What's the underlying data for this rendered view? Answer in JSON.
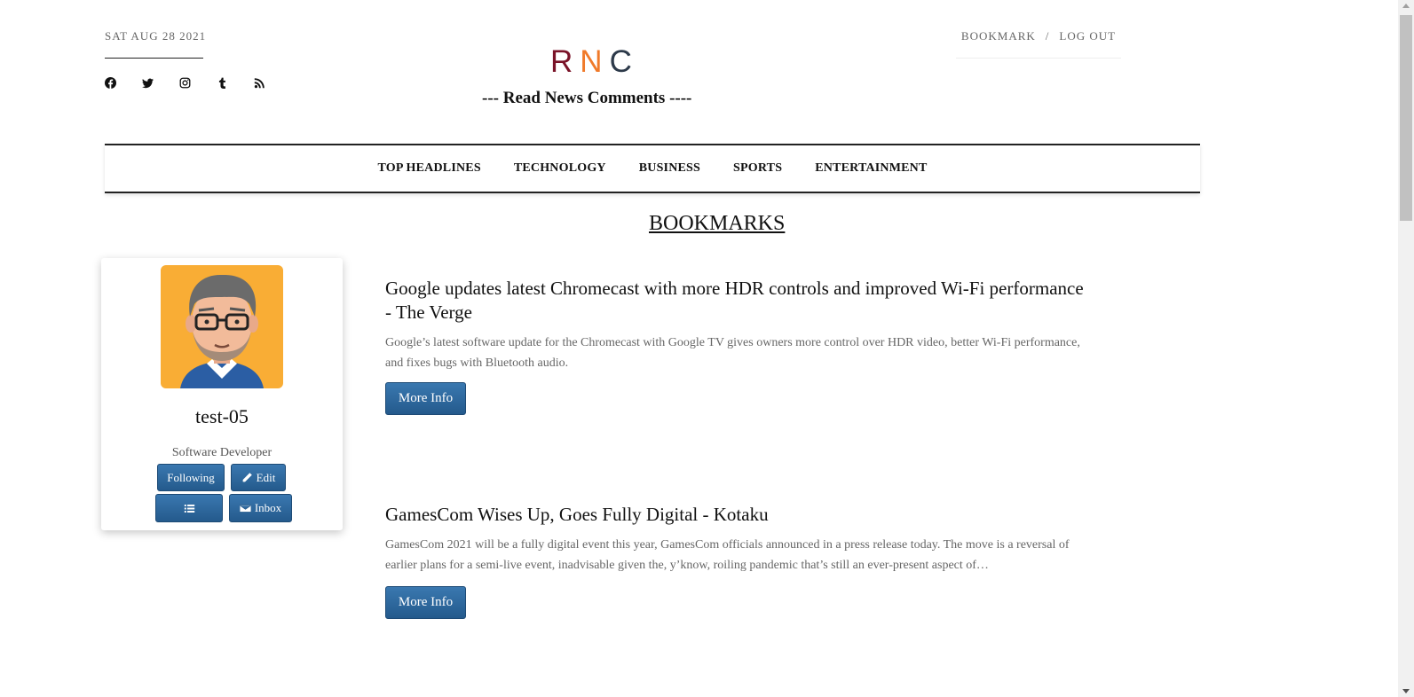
{
  "header": {
    "date": "SAT AUG 28 2021",
    "logo": {
      "r": "R",
      "n": "N",
      "c": "C"
    },
    "tagline": "--- Read News Comments ----",
    "auth": {
      "bookmark": "BOOKMARK",
      "separator": "/",
      "logout": "LOG OUT"
    },
    "socials": [
      "facebook-icon",
      "twitter-icon",
      "instagram-icon",
      "tumblr-icon",
      "rss-icon"
    ]
  },
  "nav": {
    "items": [
      "TOP HEADLINES",
      "TECHNOLOGY",
      "BUSINESS",
      "SPORTS",
      "ENTERTAINMENT"
    ]
  },
  "page_title": "BOOKMARKS",
  "profile": {
    "username": "test-05",
    "role": "Software Developer",
    "following_label": "Following",
    "edit_label": "Edit",
    "inbox_label": "Inbox"
  },
  "articles": [
    {
      "title": "Google updates latest Chromecast with more HDR controls and improved Wi-Fi performance - The Verge",
      "description": "Google’s latest software update for the Chromecast with Google TV gives owners more control over HDR video, better Wi-Fi performance, and fixes bugs with Bluetooth audio.",
      "button": "More Info"
    },
    {
      "title": "GamesCom Wises Up, Goes Fully Digital - Kotaku",
      "description": "GamesCom 2021 will be a fully digital event this year, GamesCom officials announced in a press release today. The move is a reversal of earlier plans for a semi-live event, inadvisable given the, y’know, roiling pandemic that’s still an ever-present aspect of…",
      "button": "More Info"
    }
  ],
  "colors": {
    "logo_r": "#7a1328",
    "logo_n": "#f07a2a",
    "logo_c": "#2d3a4a",
    "button": "#2f6aa0"
  }
}
